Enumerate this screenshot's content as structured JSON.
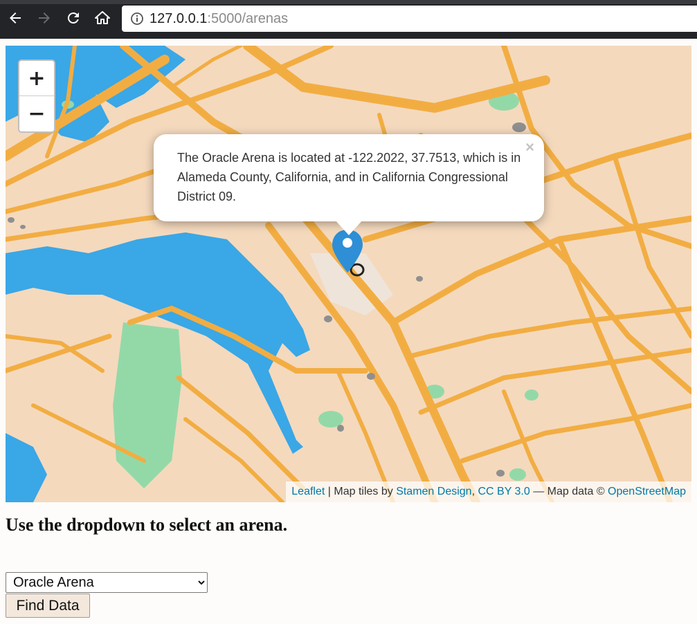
{
  "browser": {
    "url_host": "127.0.0.1",
    "url_rest": ":5000/arenas"
  },
  "map": {
    "zoom_in_label": "+",
    "zoom_out_label": "−",
    "popup": {
      "text": "The Oracle Arena is located at -122.2022, 37.7513, which is in Alameda County, California, and in California Congressional District 09.",
      "close_label": "×"
    },
    "attribution": {
      "leaflet": "Leaflet",
      "sep1": " | Map tiles by ",
      "stamen": "Stamen Design",
      "comma": ", ",
      "license": "CC BY 3.0",
      "sep2": " — Map data © ",
      "osm": "OpenStreetMap"
    },
    "colors": {
      "land": "#f4d9bd",
      "road": "#f2ad42",
      "water": "#3aa7e6",
      "park": "#93d9a8",
      "marker": "#2e8fd6"
    }
  },
  "instructions": "Use the dropdown to select an arena.",
  "arena_select": {
    "selected": "Oracle Arena"
  },
  "find_button_label": "Find Data"
}
